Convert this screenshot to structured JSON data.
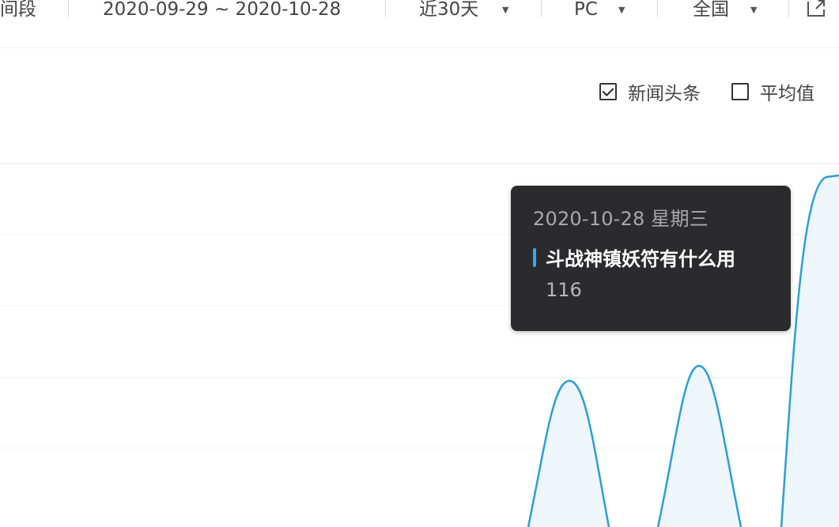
{
  "filter_bar": {
    "time_range_label": "间段",
    "date_range": "2020-09-29 ~ 2020-10-28",
    "period_select": "近30天",
    "device_select": "PC",
    "region_select": "全国"
  },
  "legend": {
    "items": [
      {
        "label": "新闻头条",
        "checked": true
      },
      {
        "label": "平均值",
        "checked": false
      }
    ]
  },
  "tooltip": {
    "date": "2020-10-28 星期三",
    "series_name": "斗战神镇妖符有什么用",
    "value": "116"
  },
  "colors": {
    "line": "#2a9fd6",
    "tooltip_bg": "#2b2b2d",
    "tooltip_marker": "#3aa5f5",
    "grid": "#e9ecef"
  },
  "icons": [
    "chevron-down-icon",
    "external-link-icon",
    "checkbox-checked-icon",
    "checkbox-unchecked-icon"
  ]
}
